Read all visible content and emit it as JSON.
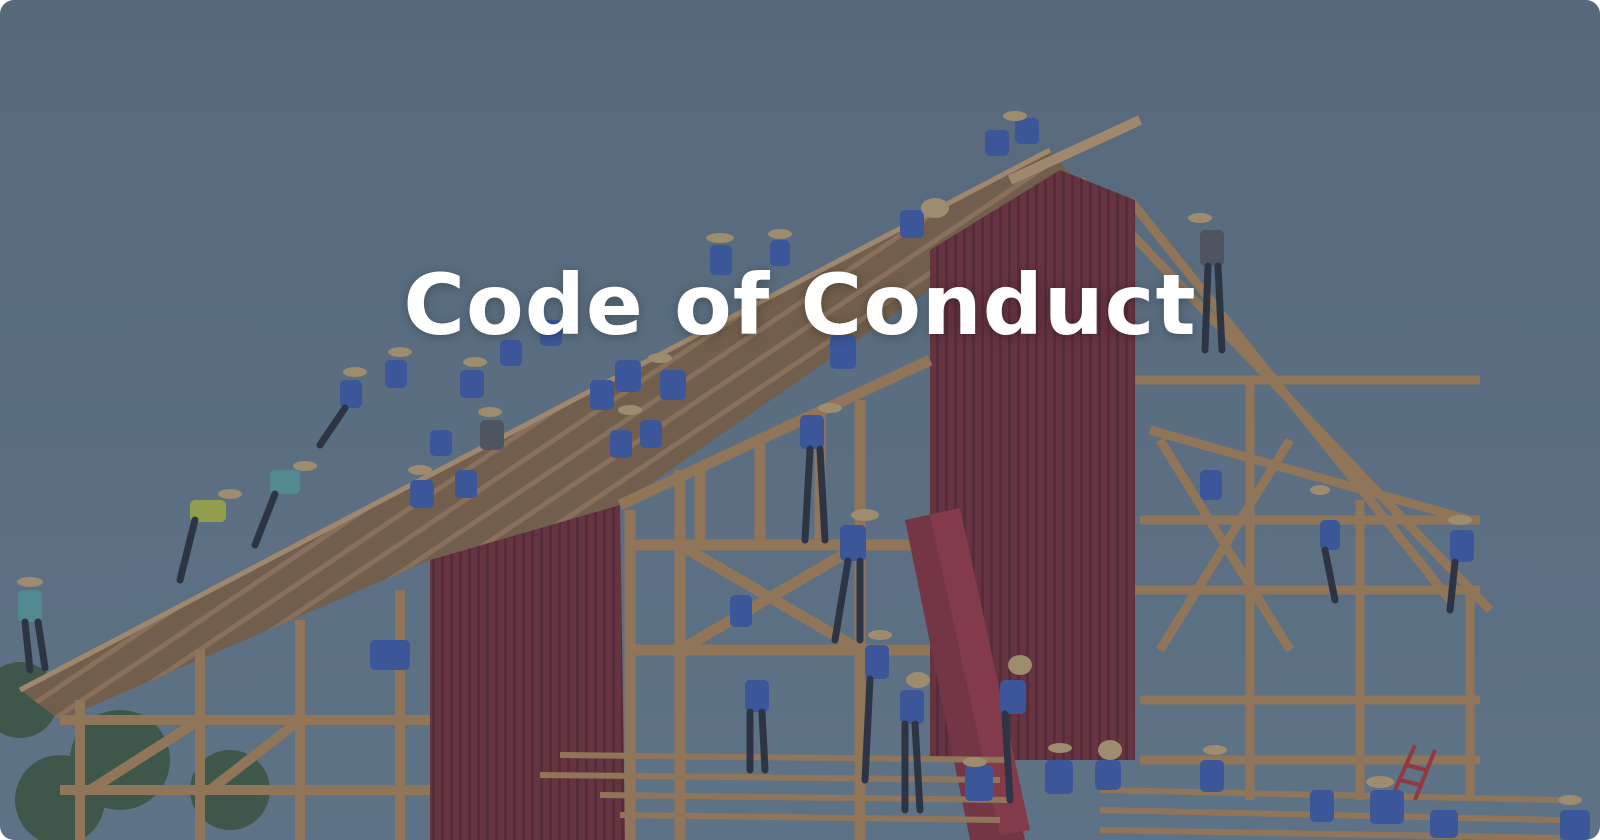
{
  "hero": {
    "title": "Code of Conduct",
    "image_subject": "barn-raising",
    "colors": {
      "sky": "#6a7f93",
      "overlay": "#344254",
      "wood": "#b48a5c",
      "barn_red": "#7a2f3a",
      "shirt_blue": "#3f5fb5",
      "title_text": "#ffffff"
    }
  }
}
